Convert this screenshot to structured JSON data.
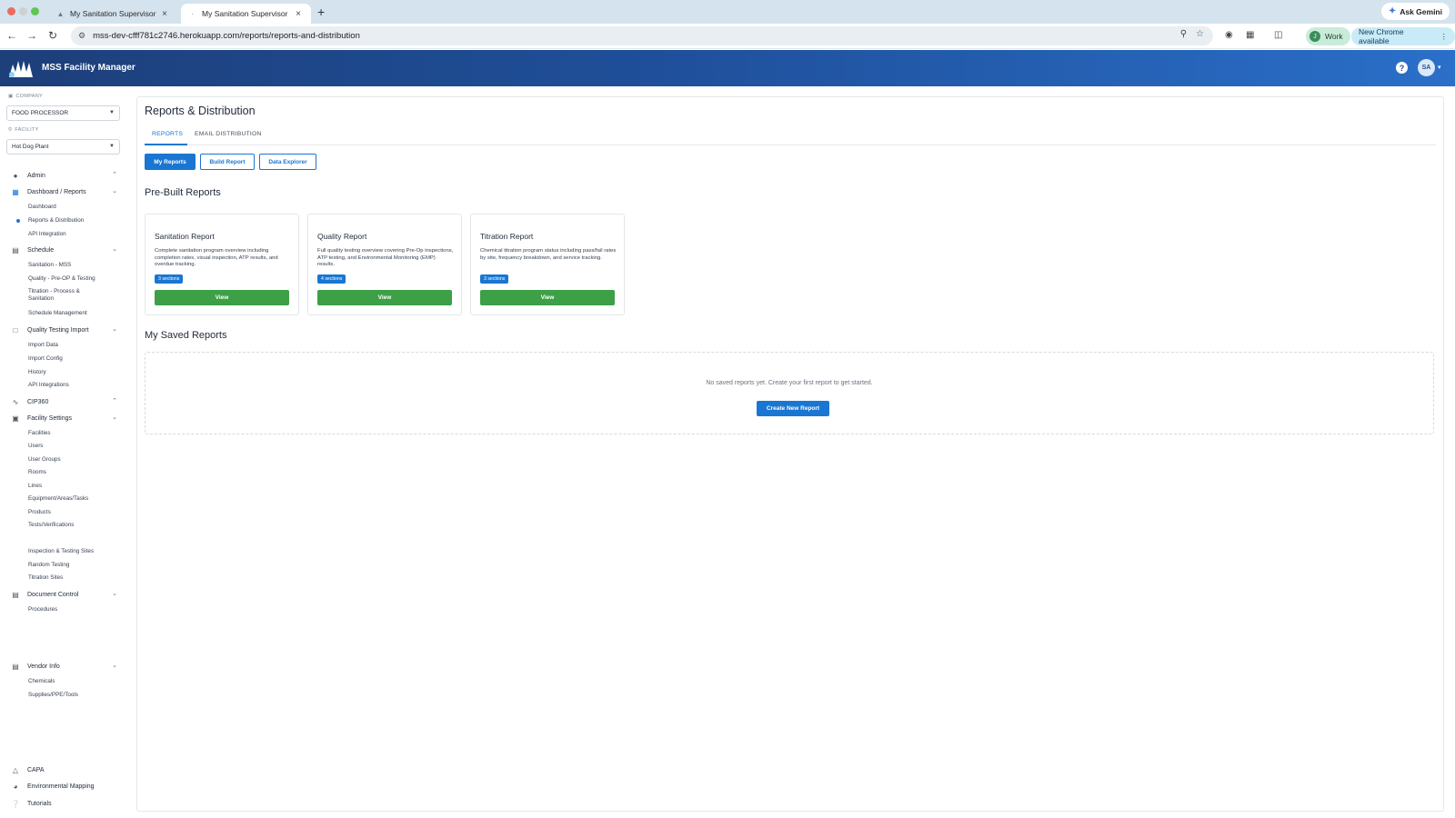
{
  "browser": {
    "tabs": [
      {
        "label": "My Sanitation Supervisor",
        "active": false
      },
      {
        "label": "My Sanitation Supervisor",
        "active": true
      }
    ],
    "url": "mss-dev-cfff781c2746.herokuapp.com/reports/reports-and-distribution",
    "ask_gemini": "Ask Gemini",
    "profile_label": "Work",
    "profile_initial": "J",
    "update_label": "New Chrome available"
  },
  "app": {
    "title": "MSS Facility Manager",
    "user_initials": "SA",
    "brand_color": "#1f4f9a"
  },
  "sidebar": {
    "company_label": "COMPANY",
    "company_value": "FOOD PROCESSOR",
    "facility_label": "FACILITY",
    "facility_value": "Hot Dog Plant",
    "sections": [
      {
        "label": "Admin",
        "icon": "admin-icon",
        "items": []
      },
      {
        "label": "Dashboard / Reports",
        "icon": "dashboard-icon",
        "items": [
          "Dashboard",
          "Reports & Distribution",
          "API Integration"
        ],
        "active_item": "Reports & Distribution"
      },
      {
        "label": "Schedule",
        "icon": "calendar-icon",
        "items": [
          "Sanitation - MSS",
          "Quality - Pre-OP & Testing",
          "Titration - Process & Sanitation",
          "Schedule Management"
        ]
      },
      {
        "label": "Quality Testing Import",
        "icon": "document-import-icon",
        "items": [
          "Import Data",
          "Import Config",
          "History",
          "API Integrations"
        ]
      },
      {
        "label": "CIP360",
        "icon": "chart-line-icon",
        "items": []
      },
      {
        "label": "Facility Settings",
        "icon": "facility-icon",
        "items": [
          "Facilities",
          "Users",
          "User Groups",
          "Rooms",
          "Lines",
          "Equipment/Areas/Tasks",
          "Products",
          "Tests/Verifications",
          "Inspection & Testing Sites",
          "Random Testing",
          "Titration Sites"
        ]
      },
      {
        "label": "Document Control",
        "icon": "clipboard-icon",
        "items": [
          "Procedures"
        ]
      },
      {
        "label": "Vendor Info",
        "icon": "vendor-icon",
        "items": [
          "Chemicals",
          "Supplies/PPE/Tools"
        ]
      },
      {
        "label": "CAPA",
        "icon": "warning-icon",
        "items": []
      },
      {
        "label": "Environmental Mapping",
        "icon": "globe-icon",
        "items": []
      },
      {
        "label": "Tutorials",
        "icon": "help-circle-icon",
        "items": []
      }
    ]
  },
  "main": {
    "title": "Reports & Distribution",
    "tabs": [
      {
        "label": "REPORTS",
        "active": true
      },
      {
        "label": "EMAIL DISTRIBUTION",
        "active": false
      }
    ],
    "buttons": {
      "my_reports": "My Reports",
      "build_report": "Build Report",
      "data_explorer": "Data Explorer"
    },
    "prebuilt_title": "Pre-Built Reports",
    "cards": [
      {
        "title": "Sanitation Report",
        "description": "Complete sanitation program overview including completion rates, visual inspection, ATP results, and overdue tracking.",
        "badge": "3 sections",
        "action": "View"
      },
      {
        "title": "Quality Report",
        "description": "Full quality testing overview covering Pre-Op inspections, ATP testing, and Environmental Monitoring (EMP) results.",
        "badge": "4 sections",
        "action": "View"
      },
      {
        "title": "Titration Report",
        "description": "Chemical titration program status including pass/fail rates by site, frequency breakdown, and service tracking.",
        "badge": "3 sections",
        "action": "View"
      }
    ],
    "saved_title": "My Saved Reports",
    "empty_text": "No saved reports yet. Create your first report to get started.",
    "create_button": "Create New Report"
  },
  "colors": {
    "primary": "#1976d2",
    "success": "#3da047"
  }
}
